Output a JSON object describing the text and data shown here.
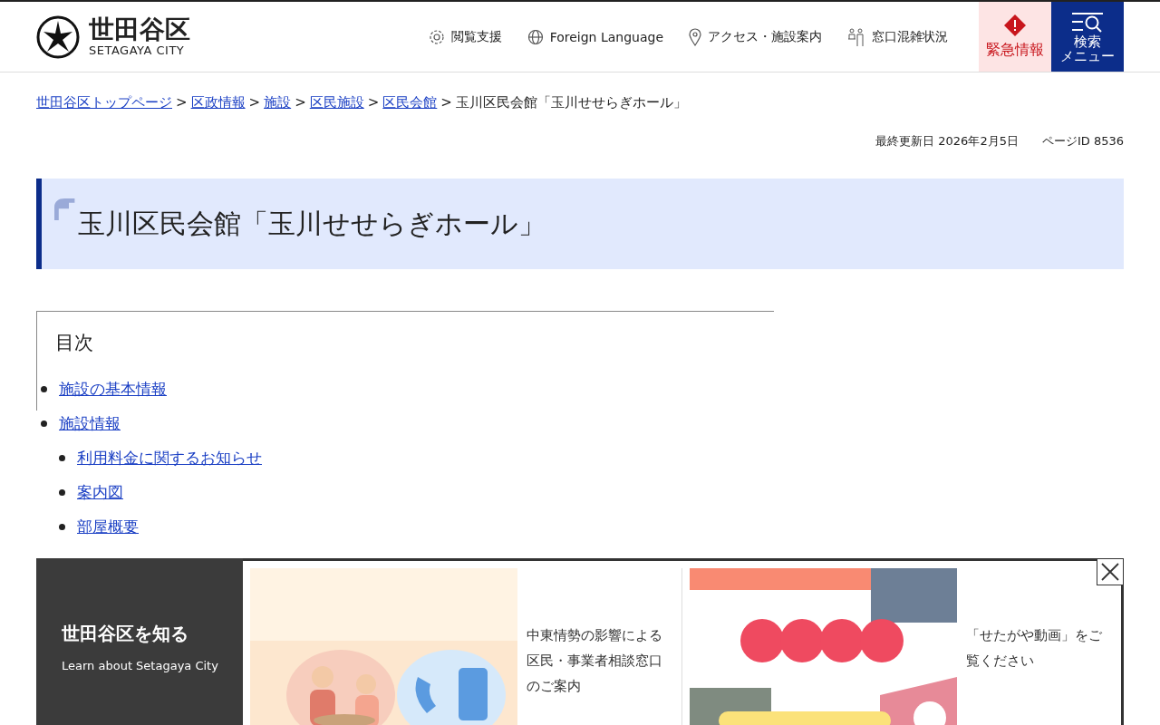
{
  "header": {
    "logo": {
      "name": "世田谷区",
      "subtitle": "SETAGAYA CITY"
    },
    "utility_links": [
      {
        "kind": "gear",
        "label": "閲覧支援"
      },
      {
        "kind": "globe",
        "label": "Foreign Language"
      },
      {
        "kind": "pin",
        "label": "アクセス・施設案内"
      },
      {
        "kind": "people",
        "label": "窓口混雑状況"
      }
    ],
    "emergency_button": "緊急情報",
    "menu_button": [
      "検索",
      "メニュー"
    ]
  },
  "breadcrumb": {
    "separator": ">",
    "links": [
      "世田谷区トップページ",
      "区政情報",
      "施設",
      "区民施設",
      "区民会館"
    ],
    "current": "玉川区民会館「玉川せせらぎホール」"
  },
  "last_updated": "最終更新日 2026年2月5日",
  "page_id": "ページID 8536",
  "title": "玉川区民会館「玉川せせらぎホール」",
  "toc": {
    "heading": "目次",
    "items": [
      {
        "label": "施設の基本情報"
      },
      {
        "label": "施設情報",
        "children": [
          {
            "label": "利用料金に関するお知らせ"
          },
          {
            "label": "案内図"
          },
          {
            "label": "部屋概要"
          }
        ]
      }
    ]
  },
  "banner": {
    "heading": "世田谷区を知る",
    "subheading": "Learn about Setagaya City",
    "cards": [
      {
        "kind": "consult",
        "caption": "中東情勢の影響による区民・事業者相談窓口のご案内"
      },
      {
        "kind": "video",
        "caption": "「せたがや動画」をご覧ください"
      }
    ]
  }
}
